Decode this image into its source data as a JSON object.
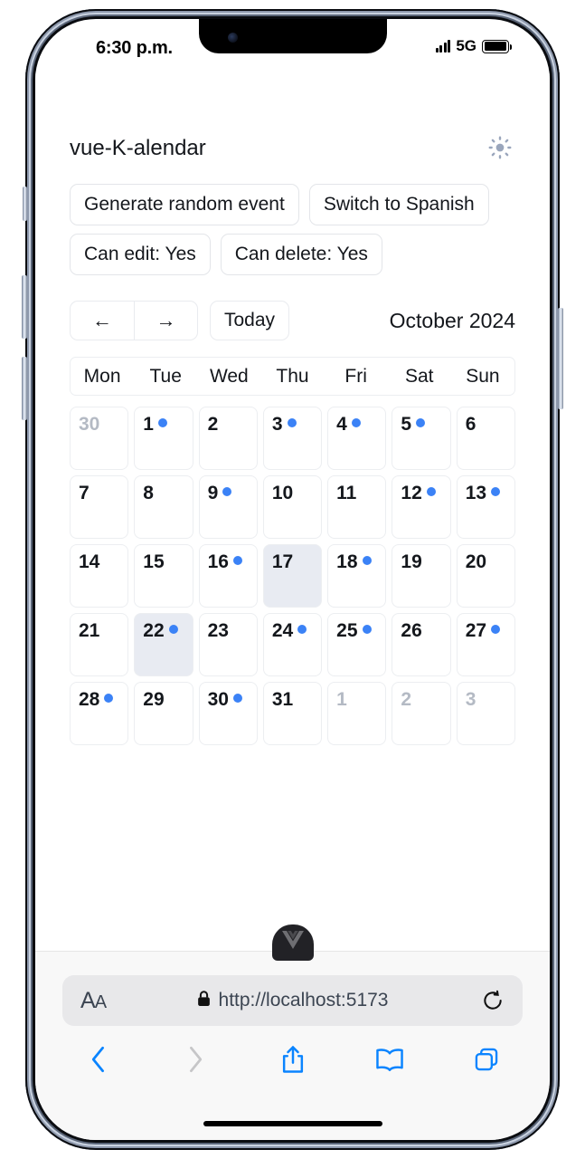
{
  "status_bar": {
    "time": "6:30 p.m.",
    "network": "5G",
    "signal_icon": "signal-bars-icon",
    "battery_icon": "battery-full-icon"
  },
  "app": {
    "title": "vue-K-alendar",
    "theme_toggle_icon": "sun-icon",
    "buttons": [
      {
        "label": "Generate random event",
        "name": "generate-random-event-button"
      },
      {
        "label": "Switch to Spanish",
        "name": "switch-language-button"
      },
      {
        "label": "Can edit: Yes",
        "name": "can-edit-toggle-button"
      },
      {
        "label": "Can delete: Yes",
        "name": "can-delete-toggle-button"
      }
    ]
  },
  "calendar": {
    "prev_label": "←",
    "next_label": "→",
    "today_label": "Today",
    "month_label": "October 2024",
    "weekdays": [
      "Mon",
      "Tue",
      "Wed",
      "Thu",
      "Fri",
      "Sat",
      "Sun"
    ],
    "accent_color": "#3b82f6",
    "selected_color": "#e8ebf2",
    "days": [
      {
        "n": "30",
        "outside": true,
        "event": false,
        "selected": false
      },
      {
        "n": "1",
        "outside": false,
        "event": true,
        "selected": false
      },
      {
        "n": "2",
        "outside": false,
        "event": false,
        "selected": false
      },
      {
        "n": "3",
        "outside": false,
        "event": true,
        "selected": false
      },
      {
        "n": "4",
        "outside": false,
        "event": true,
        "selected": false
      },
      {
        "n": "5",
        "outside": false,
        "event": true,
        "selected": false
      },
      {
        "n": "6",
        "outside": false,
        "event": false,
        "selected": false
      },
      {
        "n": "7",
        "outside": false,
        "event": false,
        "selected": false
      },
      {
        "n": "8",
        "outside": false,
        "event": false,
        "selected": false
      },
      {
        "n": "9",
        "outside": false,
        "event": true,
        "selected": false
      },
      {
        "n": "10",
        "outside": false,
        "event": false,
        "selected": false
      },
      {
        "n": "11",
        "outside": false,
        "event": false,
        "selected": false
      },
      {
        "n": "12",
        "outside": false,
        "event": true,
        "selected": false
      },
      {
        "n": "13",
        "outside": false,
        "event": true,
        "selected": false
      },
      {
        "n": "14",
        "outside": false,
        "event": false,
        "selected": false
      },
      {
        "n": "15",
        "outside": false,
        "event": false,
        "selected": false
      },
      {
        "n": "16",
        "outside": false,
        "event": true,
        "selected": false
      },
      {
        "n": "17",
        "outside": false,
        "event": false,
        "selected": true
      },
      {
        "n": "18",
        "outside": false,
        "event": true,
        "selected": false
      },
      {
        "n": "19",
        "outside": false,
        "event": false,
        "selected": false
      },
      {
        "n": "20",
        "outside": false,
        "event": false,
        "selected": false
      },
      {
        "n": "21",
        "outside": false,
        "event": false,
        "selected": false
      },
      {
        "n": "22",
        "outside": false,
        "event": true,
        "selected": true
      },
      {
        "n": "23",
        "outside": false,
        "event": false,
        "selected": false
      },
      {
        "n": "24",
        "outside": false,
        "event": true,
        "selected": false
      },
      {
        "n": "25",
        "outside": false,
        "event": true,
        "selected": false
      },
      {
        "n": "26",
        "outside": false,
        "event": false,
        "selected": false
      },
      {
        "n": "27",
        "outside": false,
        "event": true,
        "selected": false
      },
      {
        "n": "28",
        "outside": false,
        "event": true,
        "selected": false
      },
      {
        "n": "29",
        "outside": false,
        "event": false,
        "selected": false
      },
      {
        "n": "30",
        "outside": false,
        "event": true,
        "selected": false
      },
      {
        "n": "31",
        "outside": false,
        "event": false,
        "selected": false
      },
      {
        "n": "1",
        "outside": true,
        "event": false,
        "selected": false
      },
      {
        "n": "2",
        "outside": true,
        "event": false,
        "selected": false
      },
      {
        "n": "3",
        "outside": true,
        "event": false,
        "selected": false
      }
    ]
  },
  "vue_badge": {
    "icon": "vue-logo-icon"
  },
  "browser": {
    "font_size_label": "AA",
    "lock_icon": "lock-icon",
    "url": "http://localhost:5173",
    "reload_icon": "reload-icon",
    "toolbar": [
      {
        "name": "back-button",
        "icon": "chevron-left-icon",
        "enabled": true
      },
      {
        "name": "forward-button",
        "icon": "chevron-right-icon",
        "enabled": false
      },
      {
        "name": "share-button",
        "icon": "share-icon",
        "enabled": true
      },
      {
        "name": "bookmarks-button",
        "icon": "book-icon",
        "enabled": true
      },
      {
        "name": "tabs-button",
        "icon": "tabs-icon",
        "enabled": true
      }
    ]
  }
}
